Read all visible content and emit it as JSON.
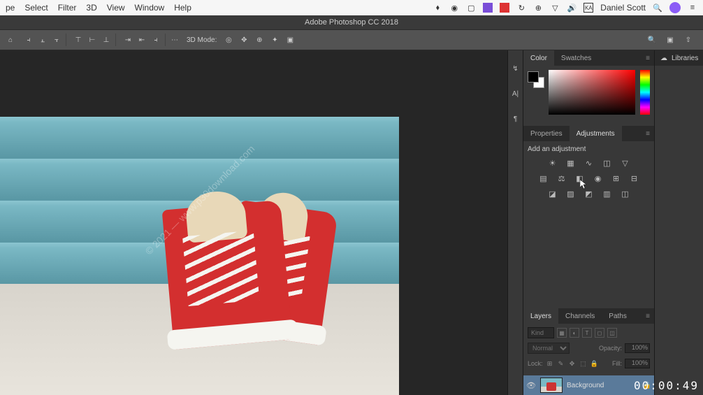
{
  "menubar": {
    "items": [
      "pe",
      "Select",
      "Filter",
      "3D",
      "View",
      "Window",
      "Help"
    ],
    "user": "Daniel Scott"
  },
  "titlebar": {
    "title": "Adobe Photoshop CC 2018"
  },
  "optionsbar": {
    "mode_label": "3D Mode:"
  },
  "panels": {
    "color": {
      "tab_color": "Color",
      "tab_swatches": "Swatches"
    },
    "adjustments": {
      "tab_properties": "Properties",
      "tab_adjustments": "Adjustments",
      "heading": "Add an adjustment"
    },
    "layers": {
      "tab_layers": "Layers",
      "tab_channels": "Channels",
      "tab_paths": "Paths",
      "kind_placeholder": "Kind",
      "blend_mode": "Normal",
      "opacity_label": "Opacity:",
      "opacity_value": "100%",
      "lock_label": "Lock:",
      "fill_label": "Fill:",
      "fill_value": "100%",
      "layer_name": "Background"
    },
    "libraries": {
      "tab": "Libraries"
    }
  },
  "watermark": "© 2021 — www.p30download.com",
  "timestamp": "00:00:49"
}
